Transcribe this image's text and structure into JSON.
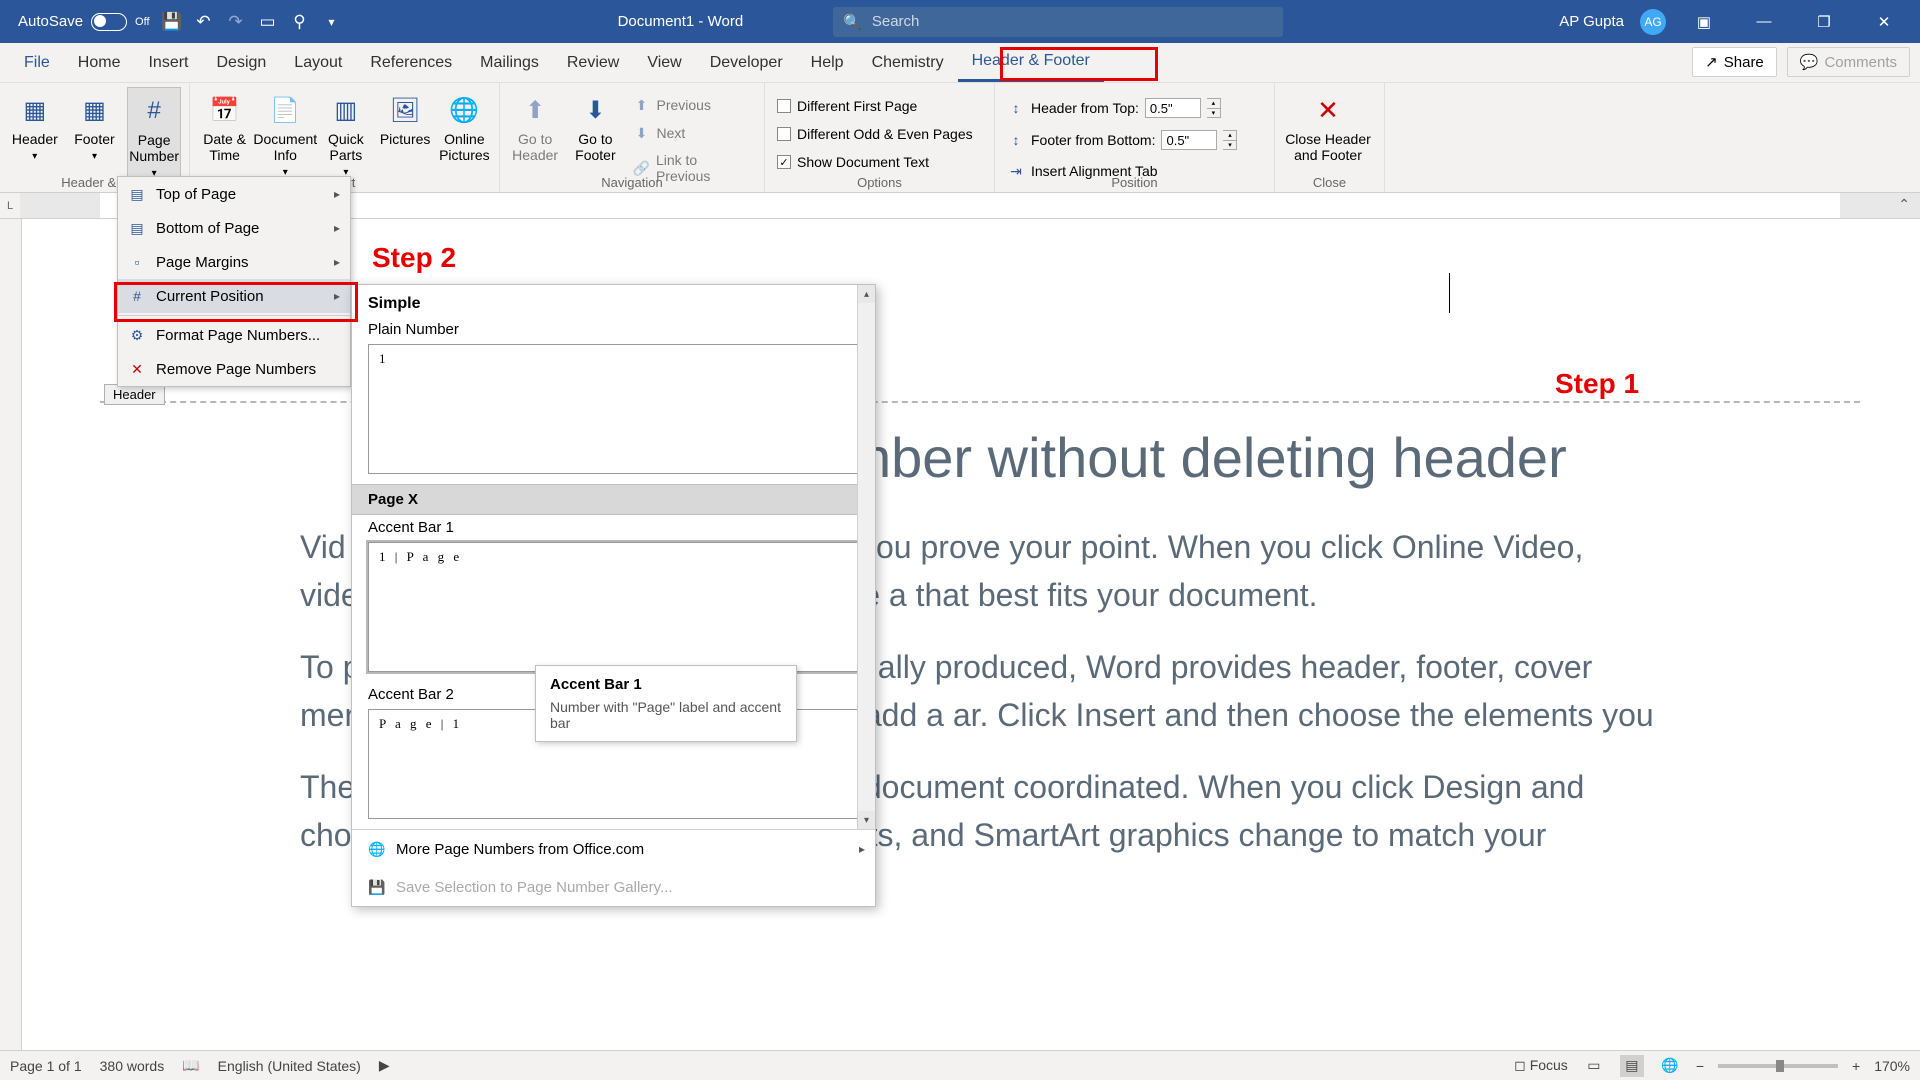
{
  "titlebar": {
    "autosave": "AutoSave",
    "autosave_state": "Off",
    "doc_title": "Document1 - Word",
    "search_placeholder": "Search",
    "user_name": "AP Gupta",
    "user_initials": "AG"
  },
  "tabs": {
    "file": "File",
    "list": [
      "Home",
      "Insert",
      "Design",
      "Layout",
      "References",
      "Mailings",
      "Review",
      "View",
      "Developer",
      "Help",
      "Chemistry"
    ],
    "active": "Header & Footer",
    "share": "Share",
    "comments": "Comments"
  },
  "ribbon": {
    "group_hf": {
      "label": "Header & F",
      "header": "Header",
      "footer": "Footer",
      "page_number": "Page Number"
    },
    "group_insert": {
      "label": "sert",
      "date_time": "Date & Time",
      "doc_info": "Document Info",
      "quick_parts": "Quick Parts",
      "pictures": "Pictures",
      "online_pictures": "Online Pictures"
    },
    "group_nav": {
      "label": "Navigation",
      "goto_header": "Go to Header",
      "goto_footer": "Go to Footer",
      "previous": "Previous",
      "next": "Next",
      "link": "Link to Previous"
    },
    "group_options": {
      "label": "Options",
      "diff_first": "Different First Page",
      "diff_odd": "Different Odd & Even Pages",
      "show_doc": "Show Document Text"
    },
    "group_position": {
      "label": "Position",
      "header_top": "Header from Top:",
      "header_val": "0.5\"",
      "footer_bottom": "Footer from Bottom:",
      "footer_val": "0.5\"",
      "align_tab": "Insert Alignment Tab"
    },
    "group_close": {
      "label": "Close",
      "close": "Close Header and Footer"
    }
  },
  "dropdown": {
    "items": [
      {
        "label": "Top of Page",
        "arrow": true
      },
      {
        "label": "Bottom of Page",
        "arrow": true
      },
      {
        "label": "Page Margins",
        "arrow": true
      },
      {
        "label": "Current Position",
        "arrow": true,
        "hover": true
      },
      {
        "label": "Format Page Numbers..."
      },
      {
        "label": "Remove Page Numbers"
      }
    ]
  },
  "submenu": {
    "cat1": "Simple",
    "item1_label": "Plain Number",
    "item1_preview": "1",
    "cat2": "Page X",
    "item2_label": "Accent Bar 1",
    "item2_preview": "1 | P a g e",
    "item3_label": "Accent Bar 2",
    "item3_preview": "P a g e | 1",
    "footer_more": "More Page Numbers from Office.com",
    "footer_save": "Save Selection to Page Number Gallery..."
  },
  "tooltip": {
    "title": "Accent Bar 1",
    "body": "Number with \"Page\" label and accent bar"
  },
  "document": {
    "header_tag": "Header",
    "title_line": "nber without deleting header",
    "p1": "you prove your point. When you click Online Video, video you want to add. You can also type a that best fits your document.",
    "p1_prefix": "Vid you key",
    "p2": "nally produced, Word provides header, footer, cover ment each other. For example, you can add a ar. Click Insert and then choose the elements you",
    "p2_prefix": "To pag ma wa",
    "p3": "Themes and styles also help keep your document coordinated. When you click Design and choose a new Theme, the pictures, charts, and SmartArt graphics change to match your"
  },
  "annotations": {
    "step1": "Step 1",
    "step2": "Step 2"
  },
  "statusbar": {
    "page": "Page 1 of 1",
    "words": "380 words",
    "lang": "English (United States)",
    "focus": "Focus",
    "zoom": "170%"
  },
  "ruler": {
    "L": "L"
  }
}
